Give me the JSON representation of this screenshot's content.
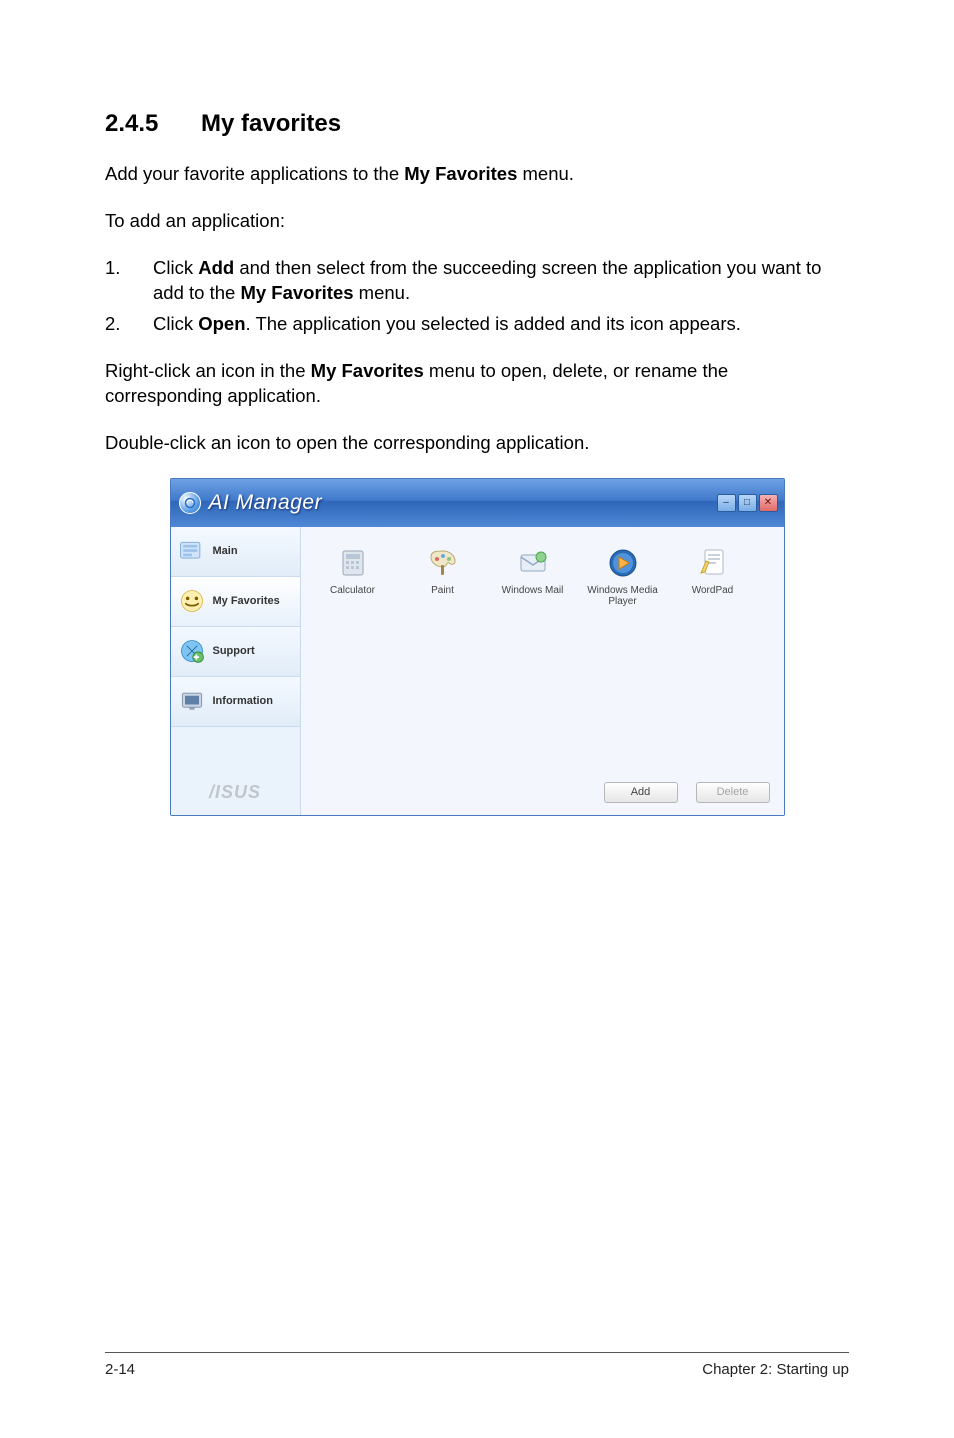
{
  "heading": {
    "number": "2.4.5",
    "title": "My favorites"
  },
  "intro_before": "Add your favorite applications to the ",
  "intro_bold": "My Favorites",
  "intro_after": " menu.",
  "to_add": "To add an application:",
  "steps": [
    {
      "n": "1.",
      "before": "Click ",
      "b1": "Add",
      "mid": " and then select from the succeeding screen the application you want to add to the ",
      "b2": "My Favorites",
      "after": " menu."
    },
    {
      "n": "2.",
      "before": "Click ",
      "b1": "Open",
      "mid": ". The application you selected is added and its icon appears.",
      "b2": "",
      "after": ""
    }
  ],
  "rc_before": "Right-click an icon in the ",
  "rc_bold": "My Favorites",
  "rc_after": " menu to open, delete, or rename the corresponding application.",
  "dbl": "Double-click an icon to open the corresponding application.",
  "ai": {
    "title": "AI Manager",
    "sidebar": {
      "main": "Main",
      "favorites": "My Favorites",
      "support": "Support",
      "information": "Information"
    },
    "brand": "/ISUS",
    "apps": {
      "calculator": "Calculator",
      "paint": "Paint",
      "mail": "Windows Mail",
      "media": "Windows Media Player",
      "wordpad": "WordPad"
    },
    "buttons": {
      "add": "Add",
      "delete": "Delete"
    }
  },
  "footer": {
    "left": "2-14",
    "right": "Chapter 2: Starting up"
  }
}
